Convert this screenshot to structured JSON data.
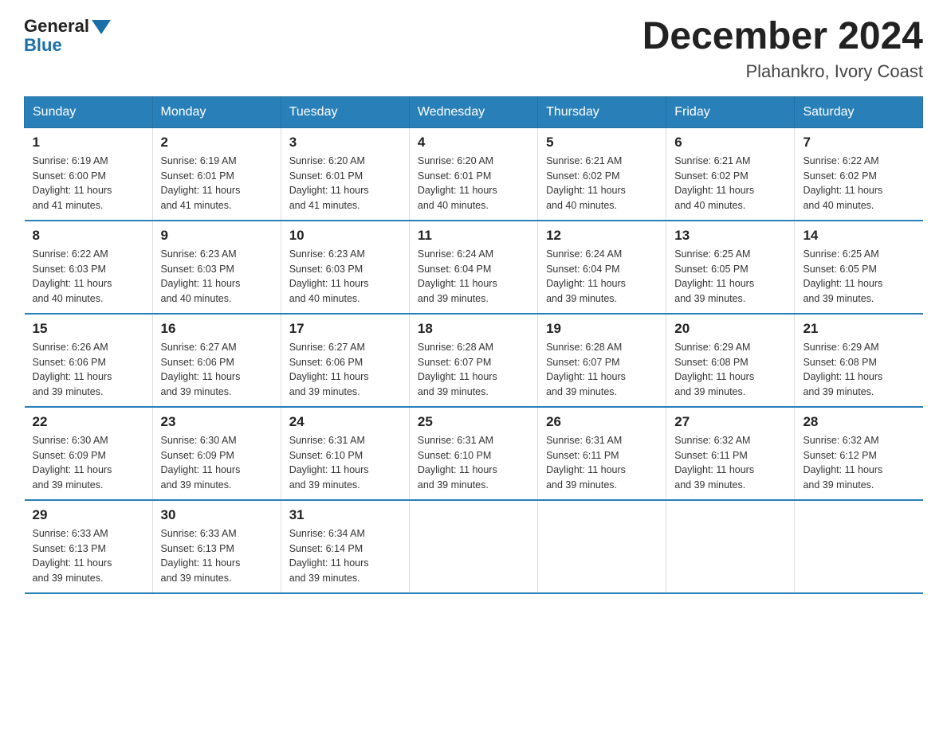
{
  "logo": {
    "general": "General",
    "blue": "Blue"
  },
  "title": {
    "month": "December 2024",
    "location": "Plahankro, Ivory Coast"
  },
  "headers": [
    "Sunday",
    "Monday",
    "Tuesday",
    "Wednesday",
    "Thursday",
    "Friday",
    "Saturday"
  ],
  "weeks": [
    [
      {
        "day": "1",
        "info": "Sunrise: 6:19 AM\nSunset: 6:00 PM\nDaylight: 11 hours\nand 41 minutes."
      },
      {
        "day": "2",
        "info": "Sunrise: 6:19 AM\nSunset: 6:01 PM\nDaylight: 11 hours\nand 41 minutes."
      },
      {
        "day": "3",
        "info": "Sunrise: 6:20 AM\nSunset: 6:01 PM\nDaylight: 11 hours\nand 41 minutes."
      },
      {
        "day": "4",
        "info": "Sunrise: 6:20 AM\nSunset: 6:01 PM\nDaylight: 11 hours\nand 40 minutes."
      },
      {
        "day": "5",
        "info": "Sunrise: 6:21 AM\nSunset: 6:02 PM\nDaylight: 11 hours\nand 40 minutes."
      },
      {
        "day": "6",
        "info": "Sunrise: 6:21 AM\nSunset: 6:02 PM\nDaylight: 11 hours\nand 40 minutes."
      },
      {
        "day": "7",
        "info": "Sunrise: 6:22 AM\nSunset: 6:02 PM\nDaylight: 11 hours\nand 40 minutes."
      }
    ],
    [
      {
        "day": "8",
        "info": "Sunrise: 6:22 AM\nSunset: 6:03 PM\nDaylight: 11 hours\nand 40 minutes."
      },
      {
        "day": "9",
        "info": "Sunrise: 6:23 AM\nSunset: 6:03 PM\nDaylight: 11 hours\nand 40 minutes."
      },
      {
        "day": "10",
        "info": "Sunrise: 6:23 AM\nSunset: 6:03 PM\nDaylight: 11 hours\nand 40 minutes."
      },
      {
        "day": "11",
        "info": "Sunrise: 6:24 AM\nSunset: 6:04 PM\nDaylight: 11 hours\nand 39 minutes."
      },
      {
        "day": "12",
        "info": "Sunrise: 6:24 AM\nSunset: 6:04 PM\nDaylight: 11 hours\nand 39 minutes."
      },
      {
        "day": "13",
        "info": "Sunrise: 6:25 AM\nSunset: 6:05 PM\nDaylight: 11 hours\nand 39 minutes."
      },
      {
        "day": "14",
        "info": "Sunrise: 6:25 AM\nSunset: 6:05 PM\nDaylight: 11 hours\nand 39 minutes."
      }
    ],
    [
      {
        "day": "15",
        "info": "Sunrise: 6:26 AM\nSunset: 6:06 PM\nDaylight: 11 hours\nand 39 minutes."
      },
      {
        "day": "16",
        "info": "Sunrise: 6:27 AM\nSunset: 6:06 PM\nDaylight: 11 hours\nand 39 minutes."
      },
      {
        "day": "17",
        "info": "Sunrise: 6:27 AM\nSunset: 6:06 PM\nDaylight: 11 hours\nand 39 minutes."
      },
      {
        "day": "18",
        "info": "Sunrise: 6:28 AM\nSunset: 6:07 PM\nDaylight: 11 hours\nand 39 minutes."
      },
      {
        "day": "19",
        "info": "Sunrise: 6:28 AM\nSunset: 6:07 PM\nDaylight: 11 hours\nand 39 minutes."
      },
      {
        "day": "20",
        "info": "Sunrise: 6:29 AM\nSunset: 6:08 PM\nDaylight: 11 hours\nand 39 minutes."
      },
      {
        "day": "21",
        "info": "Sunrise: 6:29 AM\nSunset: 6:08 PM\nDaylight: 11 hours\nand 39 minutes."
      }
    ],
    [
      {
        "day": "22",
        "info": "Sunrise: 6:30 AM\nSunset: 6:09 PM\nDaylight: 11 hours\nand 39 minutes."
      },
      {
        "day": "23",
        "info": "Sunrise: 6:30 AM\nSunset: 6:09 PM\nDaylight: 11 hours\nand 39 minutes."
      },
      {
        "day": "24",
        "info": "Sunrise: 6:31 AM\nSunset: 6:10 PM\nDaylight: 11 hours\nand 39 minutes."
      },
      {
        "day": "25",
        "info": "Sunrise: 6:31 AM\nSunset: 6:10 PM\nDaylight: 11 hours\nand 39 minutes."
      },
      {
        "day": "26",
        "info": "Sunrise: 6:31 AM\nSunset: 6:11 PM\nDaylight: 11 hours\nand 39 minutes."
      },
      {
        "day": "27",
        "info": "Sunrise: 6:32 AM\nSunset: 6:11 PM\nDaylight: 11 hours\nand 39 minutes."
      },
      {
        "day": "28",
        "info": "Sunrise: 6:32 AM\nSunset: 6:12 PM\nDaylight: 11 hours\nand 39 minutes."
      }
    ],
    [
      {
        "day": "29",
        "info": "Sunrise: 6:33 AM\nSunset: 6:13 PM\nDaylight: 11 hours\nand 39 minutes."
      },
      {
        "day": "30",
        "info": "Sunrise: 6:33 AM\nSunset: 6:13 PM\nDaylight: 11 hours\nand 39 minutes."
      },
      {
        "day": "31",
        "info": "Sunrise: 6:34 AM\nSunset: 6:14 PM\nDaylight: 11 hours\nand 39 minutes."
      },
      null,
      null,
      null,
      null
    ]
  ]
}
